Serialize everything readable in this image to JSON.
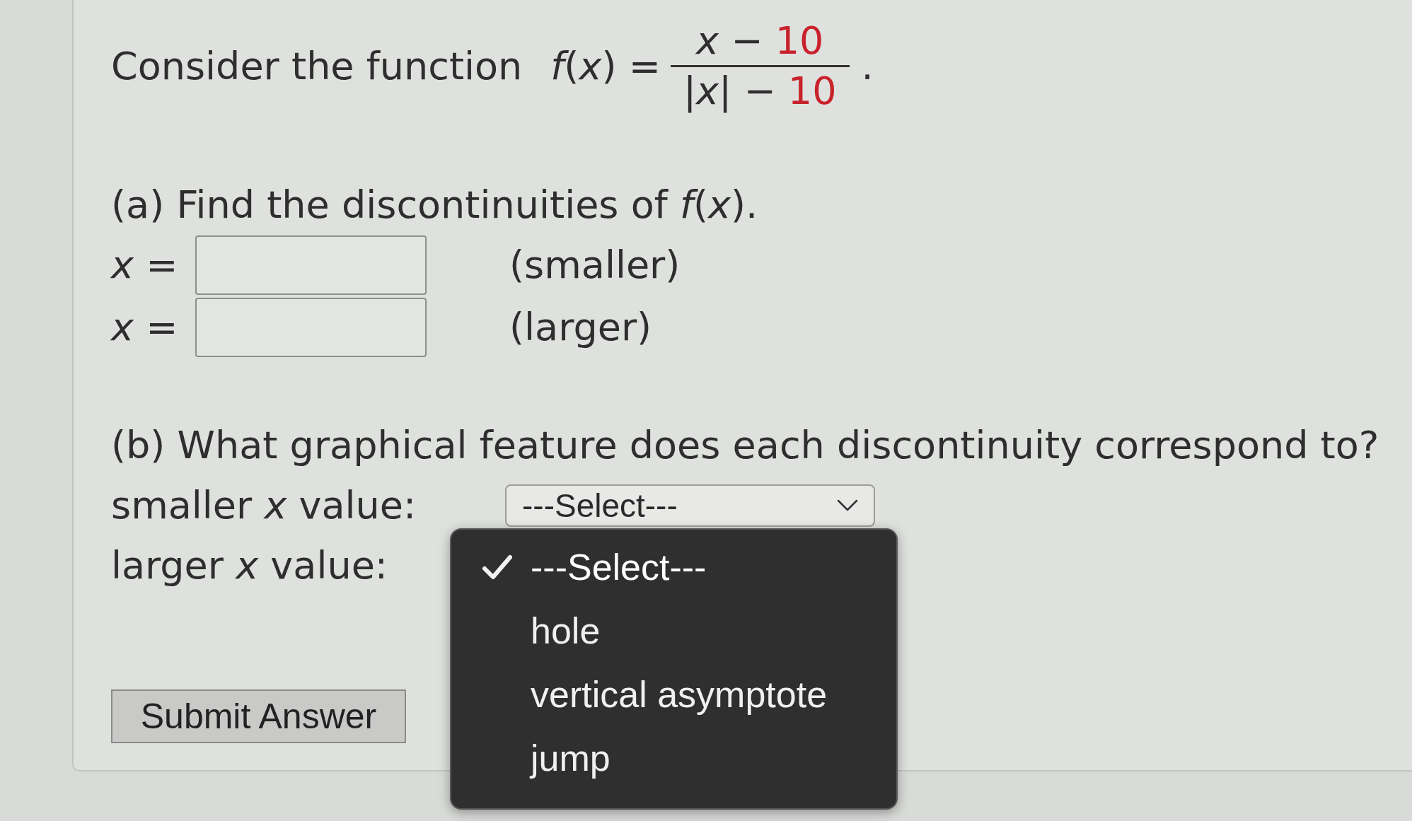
{
  "problem": {
    "intro": "Consider the function",
    "function": "*f*(*x*) =",
    "numerator": [
      {
        "kind": "plain",
        "text": "*x* −"
      },
      {
        "kind": "given",
        "text": "10"
      }
    ],
    "denominator": [
      {
        "kind": "plain",
        "text": "|*x*| −"
      },
      {
        "kind": "given",
        "text": "10"
      }
    ],
    "end_mark": "."
  },
  "part_a": {
    "question": "(a) Find the discontinuities of *f*(*x*).",
    "answers": [
      {
        "label": "*x* =",
        "hint": "(smaller)"
      },
      {
        "label": "*x* =",
        "hint": "(larger)"
      }
    ]
  },
  "part_b": {
    "question": "(b) What graphical feature does each discontinuity correspond to?",
    "rows": [
      {
        "label": "smaller *x* value:",
        "select": {
          "value": "---Select---",
          "expanded": false
        }
      },
      {
        "label": "larger *x* value:",
        "select": {
          "expanded": true,
          "options": [
            {
              "label": "---Select---",
              "selected": true
            },
            {
              "label": "hole",
              "selected": false
            },
            {
              "label": "vertical asymptote",
              "selected": false
            },
            {
              "label": "jump",
              "selected": false
            }
          ]
        }
      }
    ]
  },
  "submit_button": {
    "label": "Submit Answer"
  }
}
